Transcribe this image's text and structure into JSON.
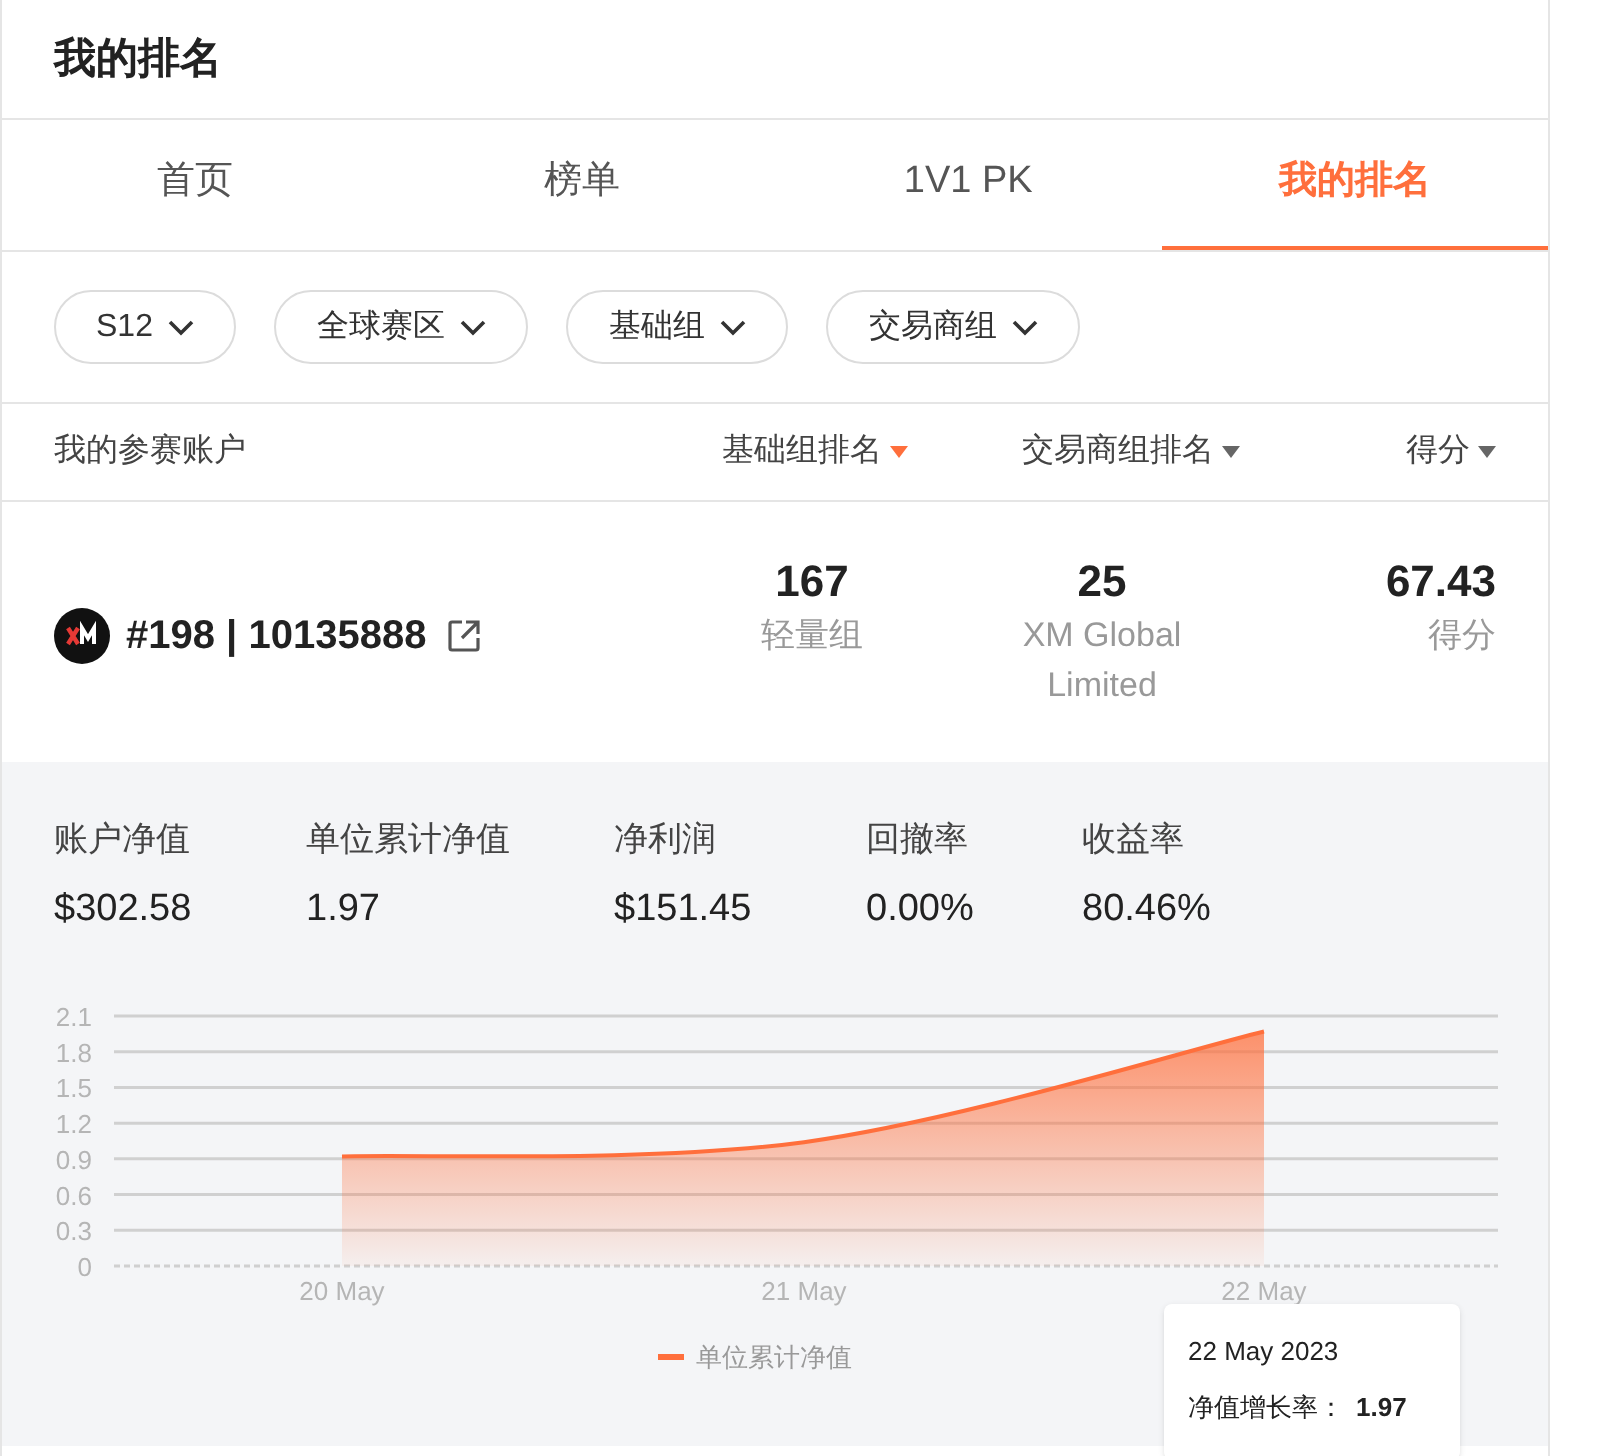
{
  "title": "我的排名",
  "tabs": [
    {
      "label": "首页",
      "selected": false
    },
    {
      "label": "榜单",
      "selected": false
    },
    {
      "label": "1V1 PK",
      "selected": false
    },
    {
      "label": "我的排名",
      "selected": true
    }
  ],
  "filters": [
    "S12",
    "全球赛区",
    "基础组",
    "交易商组"
  ],
  "table": {
    "account_header": "我的参赛账户",
    "columns": [
      {
        "label": "基础组排名",
        "selected": true
      },
      {
        "label": "交易商组排名",
        "selected": false
      },
      {
        "label": "得分",
        "selected": false
      }
    ],
    "row": {
      "account": "#198 | 10135888",
      "cells": [
        {
          "value": "167",
          "sub": "轻量组"
        },
        {
          "value": "25",
          "sub": "XM Global Limited"
        },
        {
          "value": "67.43",
          "sub": "得分"
        }
      ]
    }
  },
  "stats": [
    {
      "label": "账户净值",
      "value": "$302.58"
    },
    {
      "label": "单位累计净值",
      "value": "1.97"
    },
    {
      "label": "净利润",
      "value": "$151.45"
    },
    {
      "label": "回撤率",
      "value": "0.00%"
    },
    {
      "label": "收益率",
      "value": "80.46%"
    }
  ],
  "chart_data": {
    "type": "area",
    "categories": [
      "20 May",
      "21 May",
      "22 May"
    ],
    "series": [
      {
        "name": "单位累计净值",
        "color": "#ff6f3c",
        "values": [
          0.92,
          1.04,
          1.97
        ]
      }
    ],
    "grid": true,
    "ylim": [
      0,
      2.1
    ],
    "yticks": [
      0,
      0.3,
      0.6,
      0.9,
      1.2,
      1.5,
      1.8,
      2.1
    ]
  },
  "tooltip": {
    "date": "22 May 2023",
    "label": "净值增长率：",
    "value": "1.97"
  }
}
